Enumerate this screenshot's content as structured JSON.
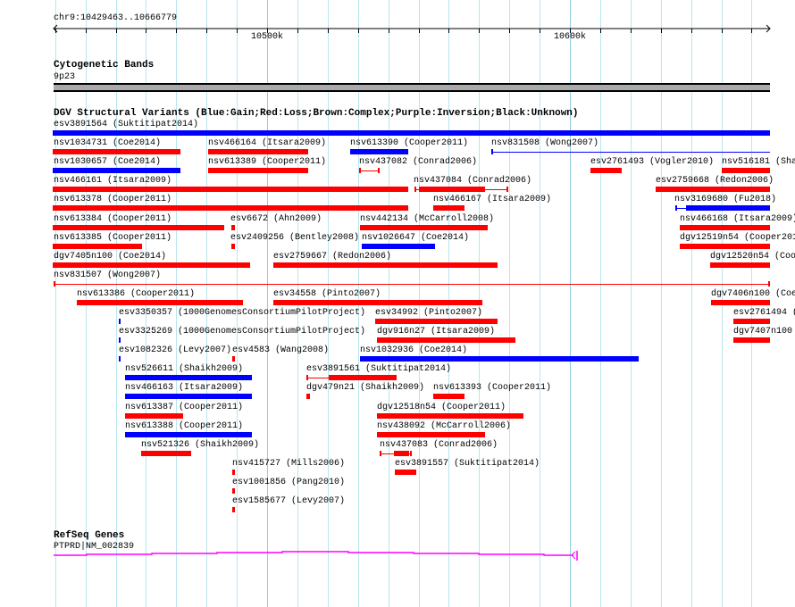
{
  "ruler": {
    "range_label": "chr9:10429463..10666779",
    "ticks": [
      "10500k",
      "10600k"
    ]
  },
  "cytoband": {
    "title": "Cytogenetic Bands",
    "band": "9p23"
  },
  "dgv": {
    "title": "DGV Structural Variants (Blue:Gain;Red:Loss;Brown:Complex;Purple:Inversion;Black:Unknown)",
    "colors": {
      "gain": "#0000ff",
      "loss": "#ff0000"
    },
    "features": [
      {
        "label": "esv3891564 (Suktitipat2014)",
        "type": "gain"
      },
      {
        "label": "nsv1034731 (Coe2014)",
        "type": "loss"
      },
      {
        "label": "nsv466164 (Itsara2009)",
        "type": "loss"
      },
      {
        "label": "nsv613390 (Cooper2011)",
        "type": "gain"
      },
      {
        "label": "nsv831508 (Wong2007)",
        "type": "gain"
      },
      {
        "label": "nsv1030657 (Coe2014)",
        "type": "gain"
      },
      {
        "label": "nsv613389 (Cooper2011)",
        "type": "loss"
      },
      {
        "label": "nsv437082 (Conrad2006)",
        "type": "loss"
      },
      {
        "label": "esv2761493 (Vogler2010)",
        "type": "loss"
      },
      {
        "label": "nsv516181 (Sha",
        "type": "loss"
      },
      {
        "label": "nsv466161 (Itsara2009)",
        "type": "loss"
      },
      {
        "label": "nsv437084 (Conrad2006)",
        "type": "loss"
      },
      {
        "label": "esv2759668 (Redon2006)",
        "type": "loss"
      },
      {
        "label": "nsv613378 (Cooper2011)",
        "type": "loss"
      },
      {
        "label": "nsv466167 (Itsara2009)",
        "type": "loss"
      },
      {
        "label": "nsv3169680 (Fu2018)",
        "type": "gain"
      },
      {
        "label": "nsv613384 (Cooper2011)",
        "type": "loss"
      },
      {
        "label": "esv6672 (Ahn2009)",
        "type": "loss"
      },
      {
        "label": "nsv442134 (McCarroll2008)",
        "type": "loss"
      },
      {
        "label": "nsv466168 (Itsara2009)",
        "type": "loss"
      },
      {
        "label": "nsv613385 (Cooper2011)",
        "type": "loss"
      },
      {
        "label": "esv2409256 (Bentley2008)",
        "type": "loss"
      },
      {
        "label": "nsv1026647 (Coe2014)",
        "type": "gain"
      },
      {
        "label": "dgv12519n54 (Cooper201",
        "type": "loss"
      },
      {
        "label": "dgv7405n100 (Coe2014)",
        "type": "loss"
      },
      {
        "label": "esv2759667 (Redon2006)",
        "type": "loss"
      },
      {
        "label": "dgv12520n54 (Coo",
        "type": "loss"
      },
      {
        "label": "nsv831507 (Wong2007)",
        "type": "loss"
      },
      {
        "label": "nsv613386 (Cooper2011)",
        "type": "loss"
      },
      {
        "label": "esv34558 (Pinto2007)",
        "type": "loss"
      },
      {
        "label": "dgv7406n100 (Coe",
        "type": "loss"
      },
      {
        "label": "esv3350357 (1000GenomesConsortiumPilotProject)",
        "type": "gain"
      },
      {
        "label": "esv34992 (Pinto2007)",
        "type": "loss"
      },
      {
        "label": "esv2761494 (",
        "type": "loss"
      },
      {
        "label": "esv3325269 (1000GenomesConsortiumPilotProject)",
        "type": "gain"
      },
      {
        "label": "dgv916n27 (Itsara2009)",
        "type": "loss"
      },
      {
        "label": "dgv7407n100",
        "type": "loss"
      },
      {
        "label": "esv1082326 (Levy2007)",
        "type": "gain"
      },
      {
        "label": "esv4583 (Wang2008)",
        "type": "loss"
      },
      {
        "label": "nsv1032936 (Coe2014)",
        "type": "gain"
      },
      {
        "label": "nsv526611 (Shaikh2009)",
        "type": "gain"
      },
      {
        "label": "esv3891561 (Suktitipat2014)",
        "type": "loss"
      },
      {
        "label": "nsv466163 (Itsara2009)",
        "type": "gain"
      },
      {
        "label": "dgv479n21 (Shaikh2009)",
        "type": "loss"
      },
      {
        "label": "nsv613393 (Cooper2011)",
        "type": "loss"
      },
      {
        "label": "nsv613387 (Cooper2011)",
        "type": "loss"
      },
      {
        "label": "dgv12518n54 (Cooper2011)",
        "type": "loss"
      },
      {
        "label": "nsv613388 (Cooper2011)",
        "type": "gain"
      },
      {
        "label": "nsv438092 (McCarroll2006)",
        "type": "loss"
      },
      {
        "label": "nsv521326 (Shaikh2009)",
        "type": "loss"
      },
      {
        "label": "nsv437083 (Conrad2006)",
        "type": "loss"
      },
      {
        "label": "nsv415727 (Mills2006)",
        "type": "loss"
      },
      {
        "label": "esv3891557 (Suktitipat2014)",
        "type": "loss"
      },
      {
        "label": "esv1001856 (Pang2010)",
        "type": "loss"
      },
      {
        "label": "esv1585677 (Levy2007)",
        "type": "loss"
      }
    ]
  },
  "refseq": {
    "title": "RefSeq Genes",
    "gene": "PTPRD|NM_002839",
    "color": "#ff00ff"
  }
}
